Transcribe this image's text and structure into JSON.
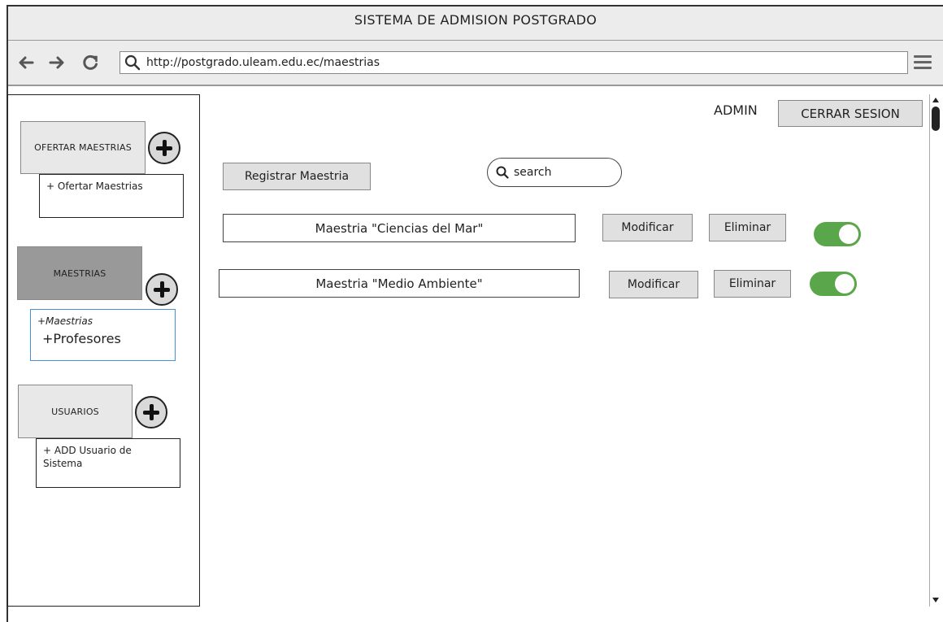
{
  "window": {
    "title": "SISTEMA DE ADMISION POSTGRADO"
  },
  "browser": {
    "back_icon": "arrow-left",
    "forward_icon": "arrow-right",
    "reload_icon": "reload",
    "search_icon": "magnifier",
    "url": "http://postgrado.uleam.edu.ec/maestrias",
    "menu_icon": "hamburger"
  },
  "sidebar": {
    "sections": [
      {
        "button": "OFERTAR MAESTRIAS",
        "items": [
          "+ Ofertar Maestrias"
        ]
      },
      {
        "button": "MAESTRIAS",
        "items": [
          "+Maestrias",
          "+Profesores"
        ]
      },
      {
        "button": "USUARIOS",
        "items": [
          "+ ADD Usuario de Sistema"
        ]
      }
    ]
  },
  "header": {
    "user": "ADMIN",
    "logout_label": "CERRAR SESION"
  },
  "toolbar": {
    "register_label": "Registrar Maestria",
    "search_placeholder": "search"
  },
  "maestrias": [
    {
      "name": "Maestria \"Ciencias del Mar\"",
      "modify_label": "Modificar",
      "delete_label": "Eliminar",
      "active": true
    },
    {
      "name": "Maestria \"Medio Ambiente\"",
      "modify_label": "Modificar",
      "delete_label": "Eliminar",
      "active": true
    }
  ],
  "colors": {
    "toggle_on": "#5aa64a",
    "active_nav": "#999999",
    "button_bg": "#e0e0e0"
  }
}
